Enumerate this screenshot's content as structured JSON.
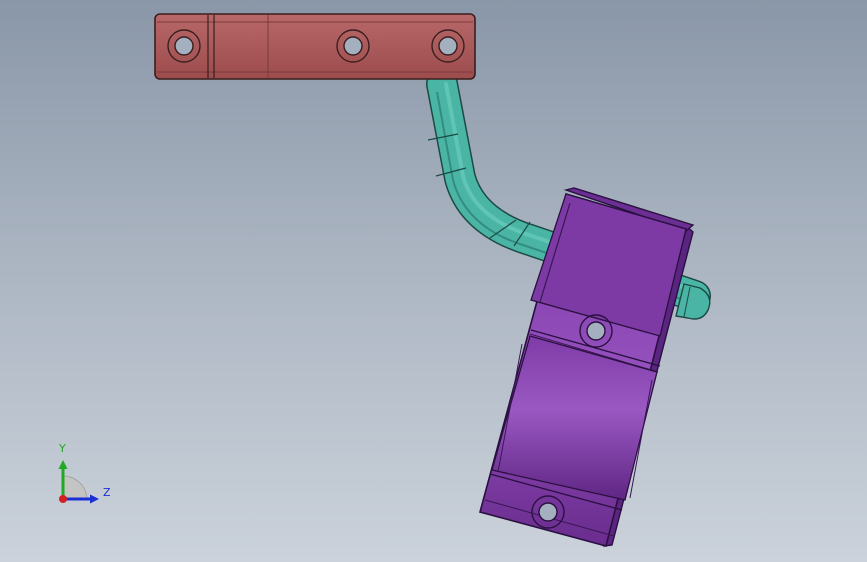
{
  "viewport": {
    "background_top": "#8a97a8",
    "background_bottom": "#cbd2db"
  },
  "parts": [
    {
      "name": "mounting-bracket",
      "color": "#b05a5a"
    },
    {
      "name": "bent-rod",
      "color": "#4ab5a5"
    },
    {
      "name": "pipe-clamp",
      "color": "#8a45b0"
    }
  ],
  "triad": {
    "y_label": "Y",
    "z_label": "Z",
    "y_color": "#22a822",
    "z_color": "#1a2fd6",
    "x_color": "#d42020"
  }
}
